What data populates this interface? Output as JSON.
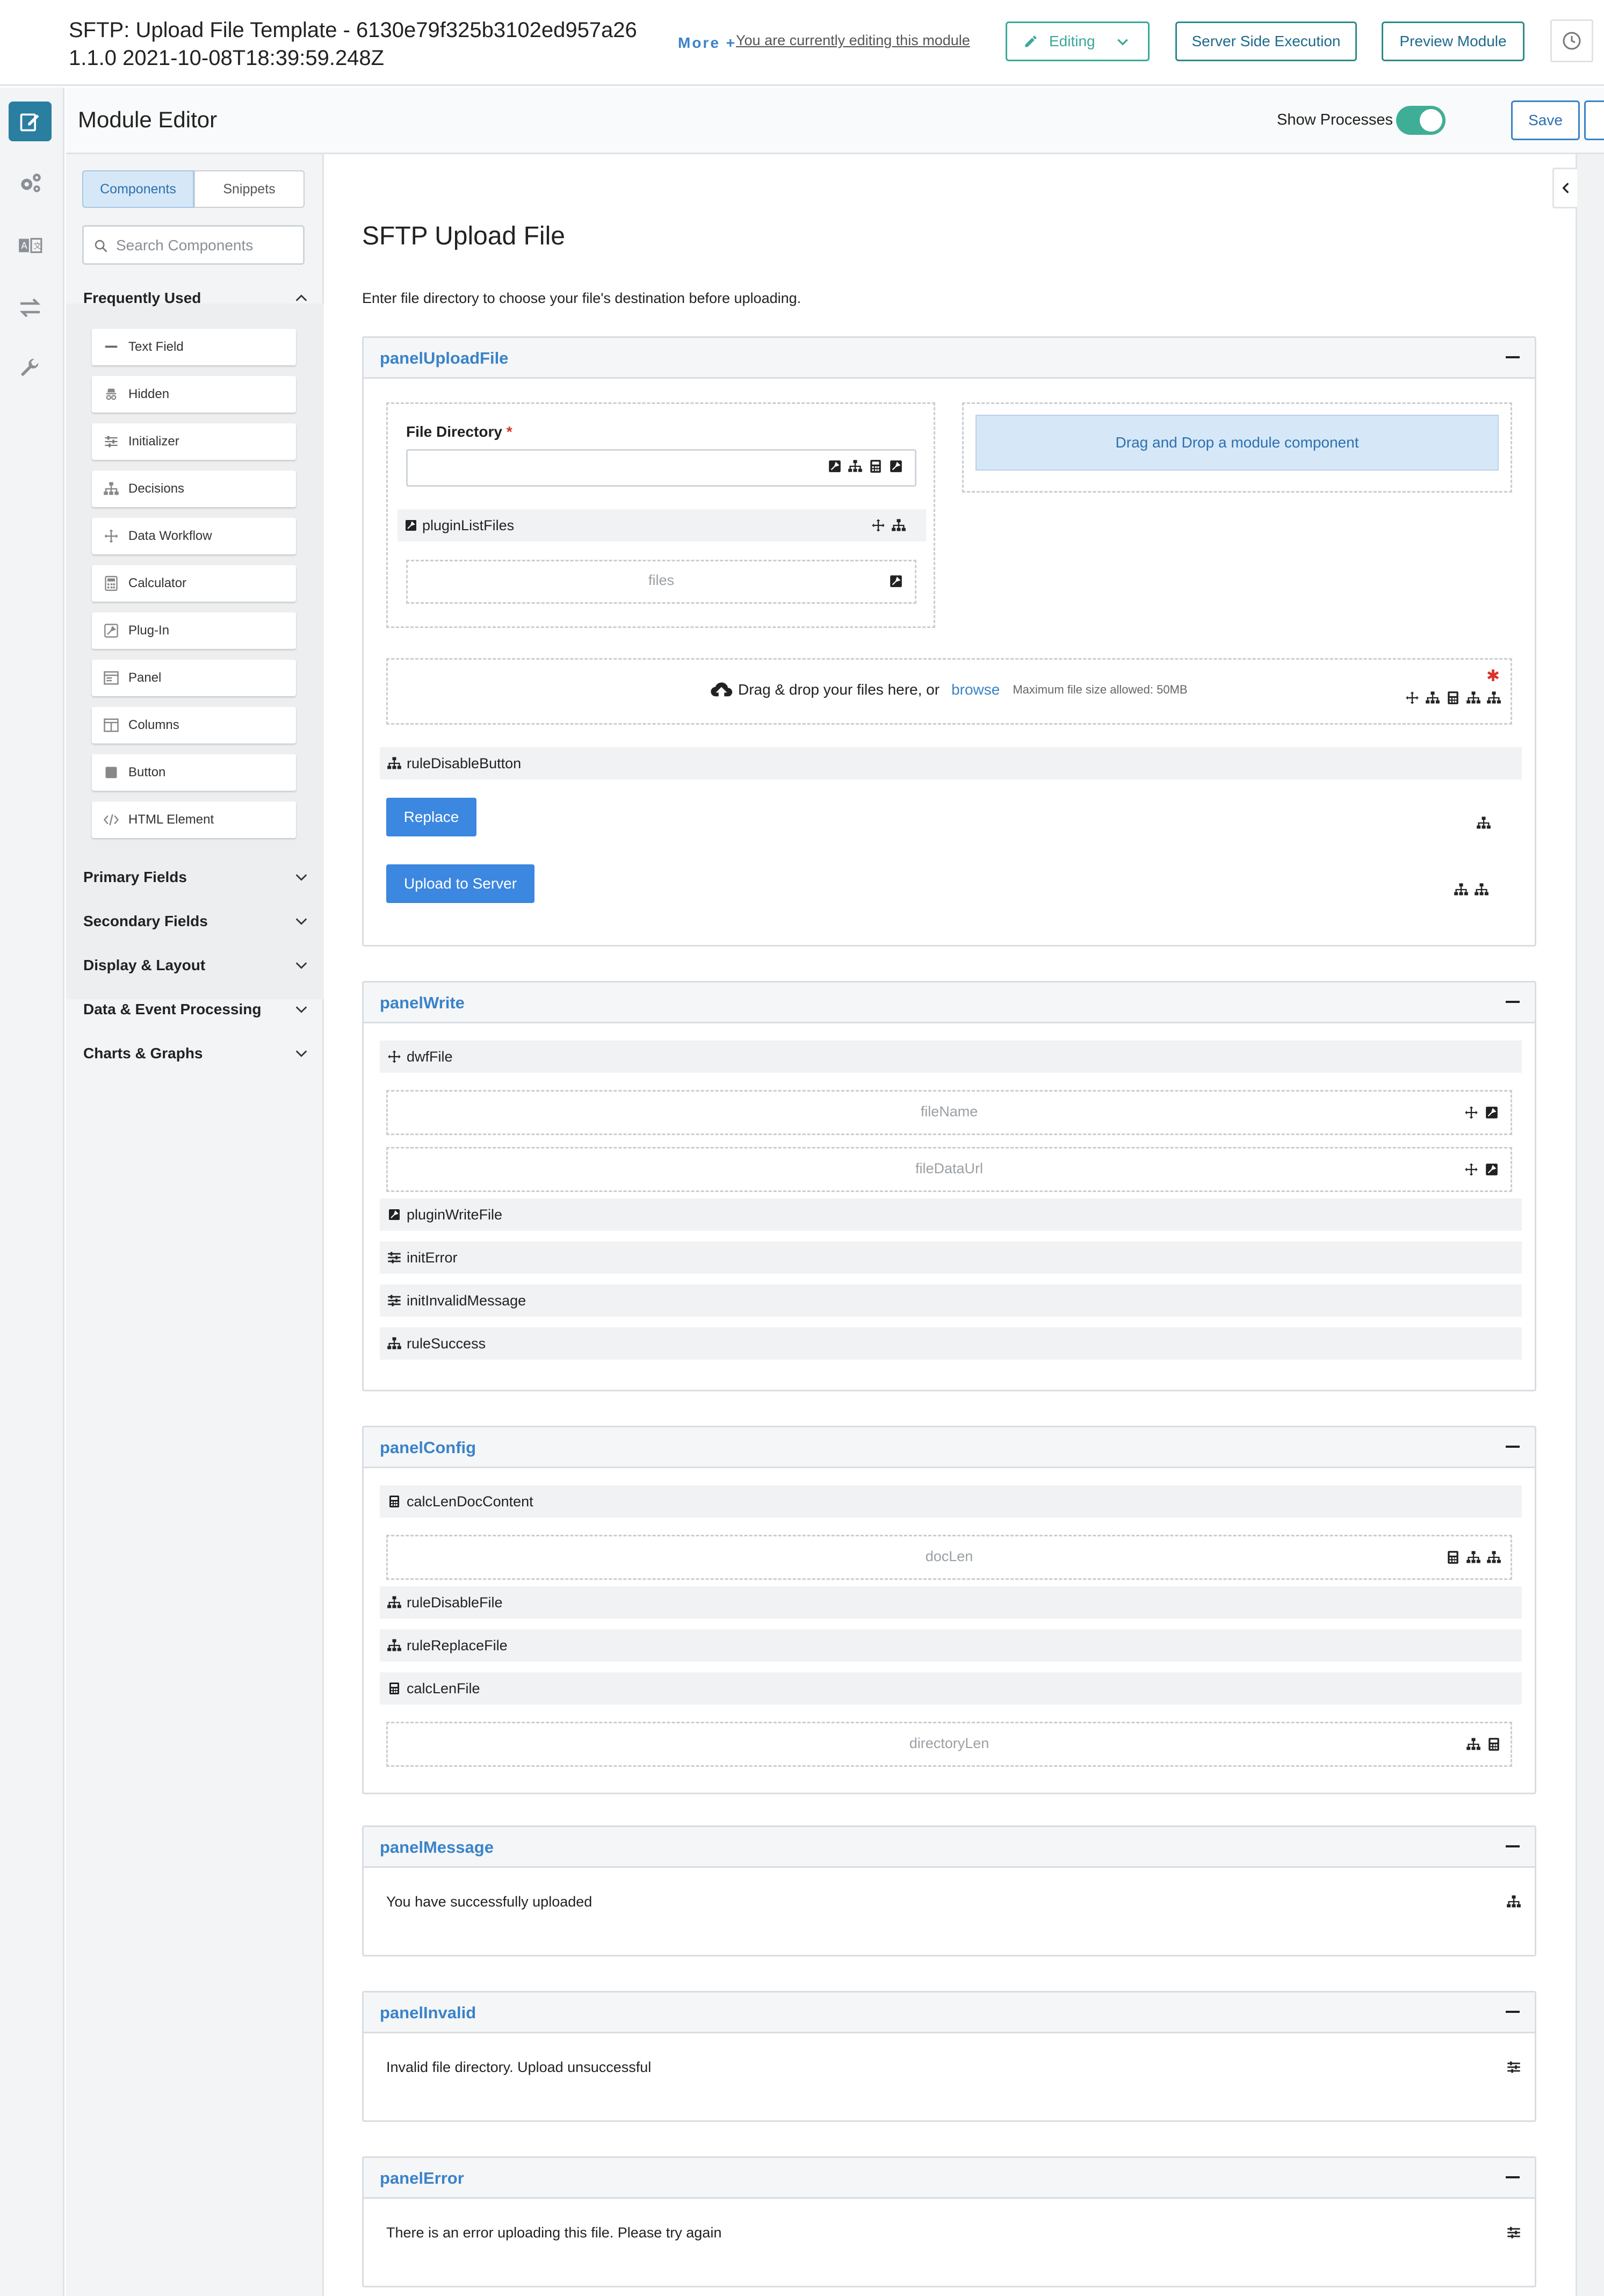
{
  "header": {
    "title": "SFTP: Upload File Template - 6130e79f325b3102ed957a26 1.1.0 2021-10-08T18:39:59.248Z",
    "more_label": "More +",
    "editing_notice": "You are currently editing this module",
    "editing_button": "Editing",
    "server_side_button": "Server Side Execution",
    "preview_button": "Preview Module"
  },
  "editor_bar": {
    "title": "Module Editor",
    "show_processes_label": "Show Processes",
    "show_processes_on": true,
    "save_label": "Save",
    "more_label": "•••"
  },
  "sidebar": {
    "tabs": [
      "Components",
      "Snippets"
    ],
    "search_placeholder": "Search Components",
    "frequently_used_label": "Frequently Used",
    "frequently_used": [
      {
        "label": "Text Field",
        "icon": "text-field-icon"
      },
      {
        "label": "Hidden",
        "icon": "hidden-icon"
      },
      {
        "label": "Initializer",
        "icon": "initializer-icon"
      },
      {
        "label": "Decisions",
        "icon": "decisions-icon"
      },
      {
        "label": "Data Workflow",
        "icon": "data-workflow-icon"
      },
      {
        "label": "Calculator",
        "icon": "calculator-icon"
      },
      {
        "label": "Plug-In",
        "icon": "plugin-icon"
      },
      {
        "label": "Panel",
        "icon": "panel-icon"
      },
      {
        "label": "Columns",
        "icon": "columns-icon"
      },
      {
        "label": "Button",
        "icon": "button-icon"
      },
      {
        "label": "HTML Element",
        "icon": "html-element-icon"
      }
    ],
    "groups": [
      "Primary Fields",
      "Secondary Fields",
      "Display & Layout",
      "Data & Event Processing",
      "Charts & Graphs"
    ]
  },
  "form": {
    "title": "SFTP Upload File",
    "instructions": "Enter file directory to choose your file's destination before uploading."
  },
  "panelUploadFile": {
    "title": "panelUploadFile",
    "file_directory_label": "File Directory",
    "required_mark": "*",
    "file_directory_value": "",
    "drag_drop_module": "Drag and Drop a module component",
    "plugin_list_files": "pluginListFiles",
    "files_label": "files",
    "upload_text": "Drag & drop your files here, or",
    "browse": "browse",
    "max_size": "Maximum file size allowed: 50MB",
    "rule_disable_button": "ruleDisableButton",
    "replace_button": "Replace",
    "upload_button": "Upload to Server"
  },
  "panelWrite": {
    "title": "panelWrite",
    "dwf_file": "dwfFile",
    "file_name": "fileName",
    "file_data_url": "fileDataUrl",
    "plugin_write_file": "pluginWriteFile",
    "init_error": "initError",
    "init_invalid_message": "initInvalidMessage",
    "rule_success": "ruleSuccess"
  },
  "panelConfig": {
    "title": "panelConfig",
    "calc_len_doc_content": "calcLenDocContent",
    "doc_len": "docLen",
    "rule_disable_file": "ruleDisableFile",
    "rule_replace_file": "ruleReplaceFile",
    "calc_len_file": "calcLenFile",
    "directory_len": "directoryLen"
  },
  "panelMessage": {
    "title": "panelMessage",
    "text": "You have successfully uploaded"
  },
  "panelInvalid": {
    "title": "panelInvalid",
    "text": "Invalid file directory. Upload unsuccessful"
  },
  "panelError": {
    "title": "panelError",
    "text": "There is an error uploading this file. Please try again"
  },
  "colors": {
    "accent_blue": "#3a83c9",
    "button_blue": "#3c87e0",
    "teal": "#3fae97",
    "rail_active": "#2a7ea0",
    "required_red": "#d9342b"
  }
}
